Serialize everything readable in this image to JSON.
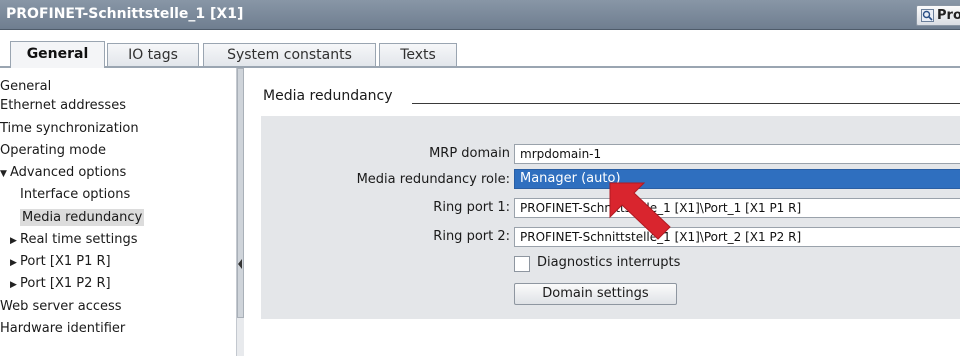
{
  "window": {
    "title": "PROFINET-Schnittstelle_1 [X1]",
    "properties_button": "Prop"
  },
  "tabs": [
    {
      "label": "General",
      "active": true
    },
    {
      "label": "IO tags"
    },
    {
      "label": "System constants"
    },
    {
      "label": "Texts"
    }
  ],
  "nav": {
    "items": [
      {
        "label": "General"
      },
      {
        "label": "Ethernet addresses"
      },
      {
        "label": "Time synchronization"
      },
      {
        "label": "Operating mode"
      },
      {
        "label": "Advanced options",
        "arrow": "▼"
      },
      {
        "label": "Interface options"
      },
      {
        "label": "Media redundancy",
        "selected": true
      },
      {
        "label": "Real time settings",
        "arrow": "▶"
      },
      {
        "label": "Port [X1 P1 R]",
        "arrow": "▶"
      },
      {
        "label": "Port [X1 P2 R]",
        "arrow": "▶"
      },
      {
        "label": "Web server access"
      },
      {
        "label": "Hardware identifier"
      }
    ]
  },
  "media_redundancy": {
    "section_title": "Media redundancy",
    "mrp_domain_label": "MRP domain",
    "mrp_domain_value": "mrpdomain-1",
    "role_label": "Media redundancy role:",
    "role_value": "Manager (auto)",
    "ring_port1_label": "Ring port 1:",
    "ring_port1_value": "PROFINET-Schnittstelle_1 [X1]\\Port_1 [X1 P1 R]",
    "ring_port2_label": "Ring port 2:",
    "ring_port2_value": "PROFINET-Schnittstelle_1 [X1]\\Port_2 [X1 P2 R]",
    "diagnostics_label": "Diagnostics interrupts",
    "diagnostics_checked": false,
    "domain_settings_button": "Domain settings"
  },
  "colors": {
    "titlebar": "#7a8899",
    "selection": "#2f6fbf",
    "annotation_arrow": "#d9252e"
  }
}
